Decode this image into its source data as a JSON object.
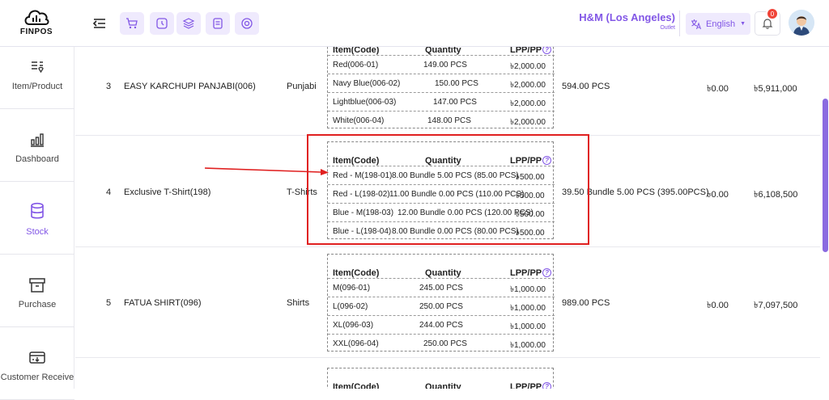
{
  "app": {
    "logo_text": "FINPOS"
  },
  "store": {
    "name": "H&M (Los Angeles)",
    "type": "Outlet"
  },
  "language": {
    "label": "English"
  },
  "notifications": {
    "count": "0"
  },
  "sidebar": {
    "items": [
      {
        "label": "Item/Product",
        "icon": "item-product-icon"
      },
      {
        "label": "Dashboard",
        "icon": "dashboard-chart-icon"
      },
      {
        "label": "Stock",
        "icon": "database-icon",
        "active": true
      },
      {
        "label": "Purchase",
        "icon": "purchase-box-icon"
      },
      {
        "label": "Customer Receive",
        "icon": "customer-receive-icon"
      }
    ]
  },
  "table": {
    "sub_headers": {
      "item": "Item(Code)",
      "qty": "Quantity",
      "lpp": "LPP/PP",
      "help": "?"
    },
    "rows": [
      {
        "sl": "3",
        "product": "EASY KARCHUPI PANJABI(006)",
        "category": "Punjabi",
        "variants": [
          {
            "code": "Red(006-01)",
            "qty": "149.00 PCS",
            "price": "৳2,000.00"
          },
          {
            "code": "Navy Blue(006-02)",
            "qty": "150.00 PCS",
            "price": "৳2,000.00"
          },
          {
            "code": "Lightblue(006-03)",
            "qty": "147.00 PCS",
            "price": "৳2,000.00"
          },
          {
            "code": "White(006-04)",
            "qty": "148.00 PCS",
            "price": "৳2,000.00"
          }
        ],
        "total_qty": "594.00 PCS",
        "col_a": "৳0.00",
        "col_b": "৳5,911,000"
      },
      {
        "sl": "4",
        "product": "Exclusive T-Shirt(198)",
        "category": "T-Shirts",
        "variants": [
          {
            "code": "Red - M(198-01)",
            "qty": "8.00 Bundle 5.00 PCS (85.00 PCS)",
            "price": "৳500.00"
          },
          {
            "code": "Red - L(198-02)",
            "qty": "11.00 Bundle 0.00 PCS (110.00 PCS)",
            "price": "৳500.00"
          },
          {
            "code": "Blue - M(198-03)",
            "qty": "12.00 Bundle 0.00 PCS (120.00 PCS)",
            "price": "৳500.00"
          },
          {
            "code": "Blue - L(198-04)",
            "qty": "8.00 Bundle 0.00 PCS (80.00 PCS)",
            "price": "৳500.00"
          }
        ],
        "total_qty": "39.50 Bundle 5.00 PCS (395.00PCS)",
        "col_a": "৳0.00",
        "col_b": "৳6,108,500"
      },
      {
        "sl": "5",
        "product": "FATUA SHIRT(096)",
        "category": "Shirts",
        "variants": [
          {
            "code": "M(096-01)",
            "qty": "245.00 PCS",
            "price": "৳1,000.00"
          },
          {
            "code": "L(096-02)",
            "qty": "250.00 PCS",
            "price": "৳1,000.00"
          },
          {
            "code": "XL(096-03)",
            "qty": "244.00 PCS",
            "price": "৳1,000.00"
          },
          {
            "code": "XXL(096-04)",
            "qty": "250.00 PCS",
            "price": "৳1,000.00"
          }
        ],
        "total_qty": "989.00 PCS",
        "col_a": "৳0.00",
        "col_b": "৳7,097,500"
      }
    ]
  },
  "colors": {
    "accent": "#8257e6",
    "highlight_box": "#e02020"
  }
}
